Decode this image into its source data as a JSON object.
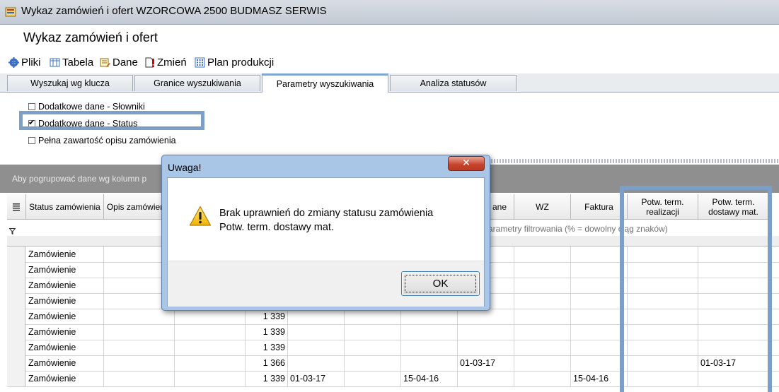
{
  "window": {
    "title": "Wykaz zamówień i ofert WZORCOWA 2500 BUDMASZ SERWIS"
  },
  "page_title": "Wykaz zamówień i ofert",
  "toolbar": {
    "items": [
      {
        "label": "Pliki",
        "icon": "files-icon"
      },
      {
        "label": "Tabela",
        "icon": "table-icon"
      },
      {
        "label": "Dane",
        "icon": "edit-data-icon"
      },
      {
        "label": "Zmień",
        "icon": "change-icon"
      },
      {
        "label": "Plan produkcji",
        "icon": "production-plan-icon"
      }
    ]
  },
  "tabs": [
    {
      "label": "Wyszukaj wg klucza"
    },
    {
      "label": "Granice wyszukiwania"
    },
    {
      "label": "Parametry wyszukiwania",
      "active": true
    },
    {
      "label": "Analiza statusów"
    }
  ],
  "options": [
    {
      "label": "Dodatkowe dane - Słowniki",
      "checked": false
    },
    {
      "label": "Dodatkowe dane - Status",
      "checked": true
    },
    {
      "label": "Pełna zawartość opisu zamówienia",
      "checked": false
    }
  ],
  "group_bar": {
    "text": "Aby pogrupować dane wg kolumn p"
  },
  "grid": {
    "columns": [
      {
        "label": "Status zamówienia"
      },
      {
        "label": "Opis zamówienia"
      },
      {
        "label": ""
      },
      {
        "label": ""
      },
      {
        "label": ""
      },
      {
        "label": ""
      },
      {
        "label": ""
      },
      {
        "label": "ane"
      },
      {
        "label": "WZ"
      },
      {
        "label": "Faktura"
      },
      {
        "label": "Potw. term. realizacji"
      },
      {
        "label": "Potw. term. dostawy mat."
      }
    ],
    "filter_hint": "arametry filtrowania (% = dowolny ciąg znaków)",
    "rows": [
      [
        "Zamówienie",
        "",
        "",
        "",
        "",
        "",
        "",
        "",
        "",
        "",
        "",
        ""
      ],
      [
        "Zamówienie",
        "",
        "",
        "",
        "",
        "",
        "",
        "",
        "",
        "",
        "",
        ""
      ],
      [
        "Zamówienie",
        "",
        "",
        "",
        "",
        "",
        "",
        "",
        "",
        "",
        "",
        ""
      ],
      [
        "Zamówienie",
        "",
        "",
        "",
        "",
        "",
        "",
        "",
        "",
        "",
        "",
        ""
      ],
      [
        "Zamówienie",
        "",
        "",
        "1 339",
        "",
        "",
        "",
        "",
        "",
        "",
        "",
        ""
      ],
      [
        "Zamówienie",
        "",
        "",
        "1 339",
        "",
        "",
        "",
        "",
        "",
        "",
        "",
        ""
      ],
      [
        "Zamówienie",
        "",
        "",
        "1 339",
        "",
        "",
        "",
        "",
        "",
        "",
        "",
        ""
      ],
      [
        "Zamówienie",
        "",
        "",
        "1 366",
        "",
        "",
        "",
        "01-03-17",
        "",
        "",
        "",
        "01-03-17"
      ],
      [
        "Zamówienie",
        "",
        "",
        "1 339",
        "01-03-17",
        "",
        "15-04-16",
        "",
        "",
        "15-04-16",
        "",
        ""
      ]
    ]
  },
  "dialog": {
    "title": "Uwaga!",
    "close_label": "✕",
    "message_line1": "Brak uprawnień do zmiany statusu zamówienia",
    "message_line2": "Potw. term. dostawy mat.",
    "ok_label": "OK"
  },
  "colors": {
    "highlight": "#7b9fc6",
    "dialog_frame": "#a9c6e6",
    "close_button": "#c7412a"
  }
}
